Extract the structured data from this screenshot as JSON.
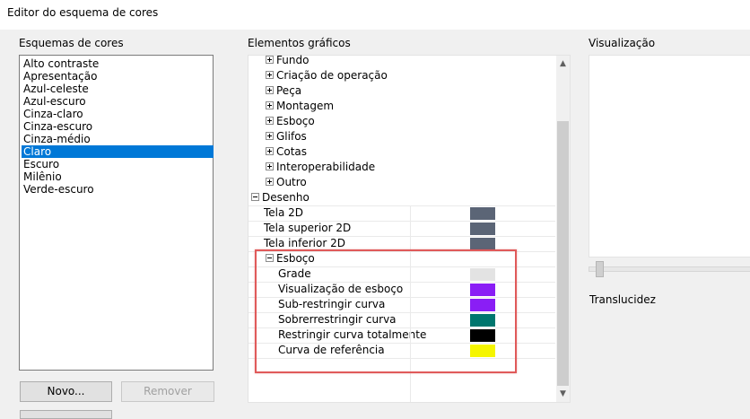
{
  "window": {
    "title": "Editor do esquema de cores"
  },
  "schemes": {
    "label": "Esquemas de cores",
    "items": [
      "Alto contraste",
      "Apresentação",
      "Azul-celeste",
      "Azul-escuro",
      "Cinza-claro",
      "Cinza-escuro",
      "Cinza-médio",
      "Claro",
      "Escuro",
      "Milênio",
      "Verde-escuro"
    ],
    "selected": "Claro",
    "new_button": "Novo...",
    "remove_button": "Remover"
  },
  "elements": {
    "label": "Elementos gráficos",
    "groups": [
      "Fundo",
      "Criação de operação",
      "Peça",
      "Montagem",
      "Esboço",
      "Glifos",
      "Cotas",
      "Interoperabilidade",
      "Outro"
    ],
    "drawing": {
      "label": "Desenho",
      "items": [
        {
          "label": "Tela 2D",
          "color": "#5b6576"
        },
        {
          "label": "Tela superior 2D",
          "color": "#5b6576"
        },
        {
          "label": "Tela inferior 2D",
          "color": "#5b6576"
        }
      ],
      "sketch": {
        "label": "Esboço",
        "items": [
          {
            "label": "Grade",
            "color": "#e3e3e3"
          },
          {
            "label": "Visualização de esboço",
            "color": "#8a1ef5"
          },
          {
            "label": "Sub-restringir curva",
            "color": "#8a1ef5"
          },
          {
            "label": "Sobrerrestringir curva",
            "color": "#00766e"
          },
          {
            "label": "Restringir curva totalmente",
            "color": "#000000"
          },
          {
            "label": "Curva de referência",
            "color": "#f5f500"
          }
        ]
      }
    }
  },
  "preview": {
    "label": "Visualização",
    "translucency_label": "Translucidez"
  }
}
